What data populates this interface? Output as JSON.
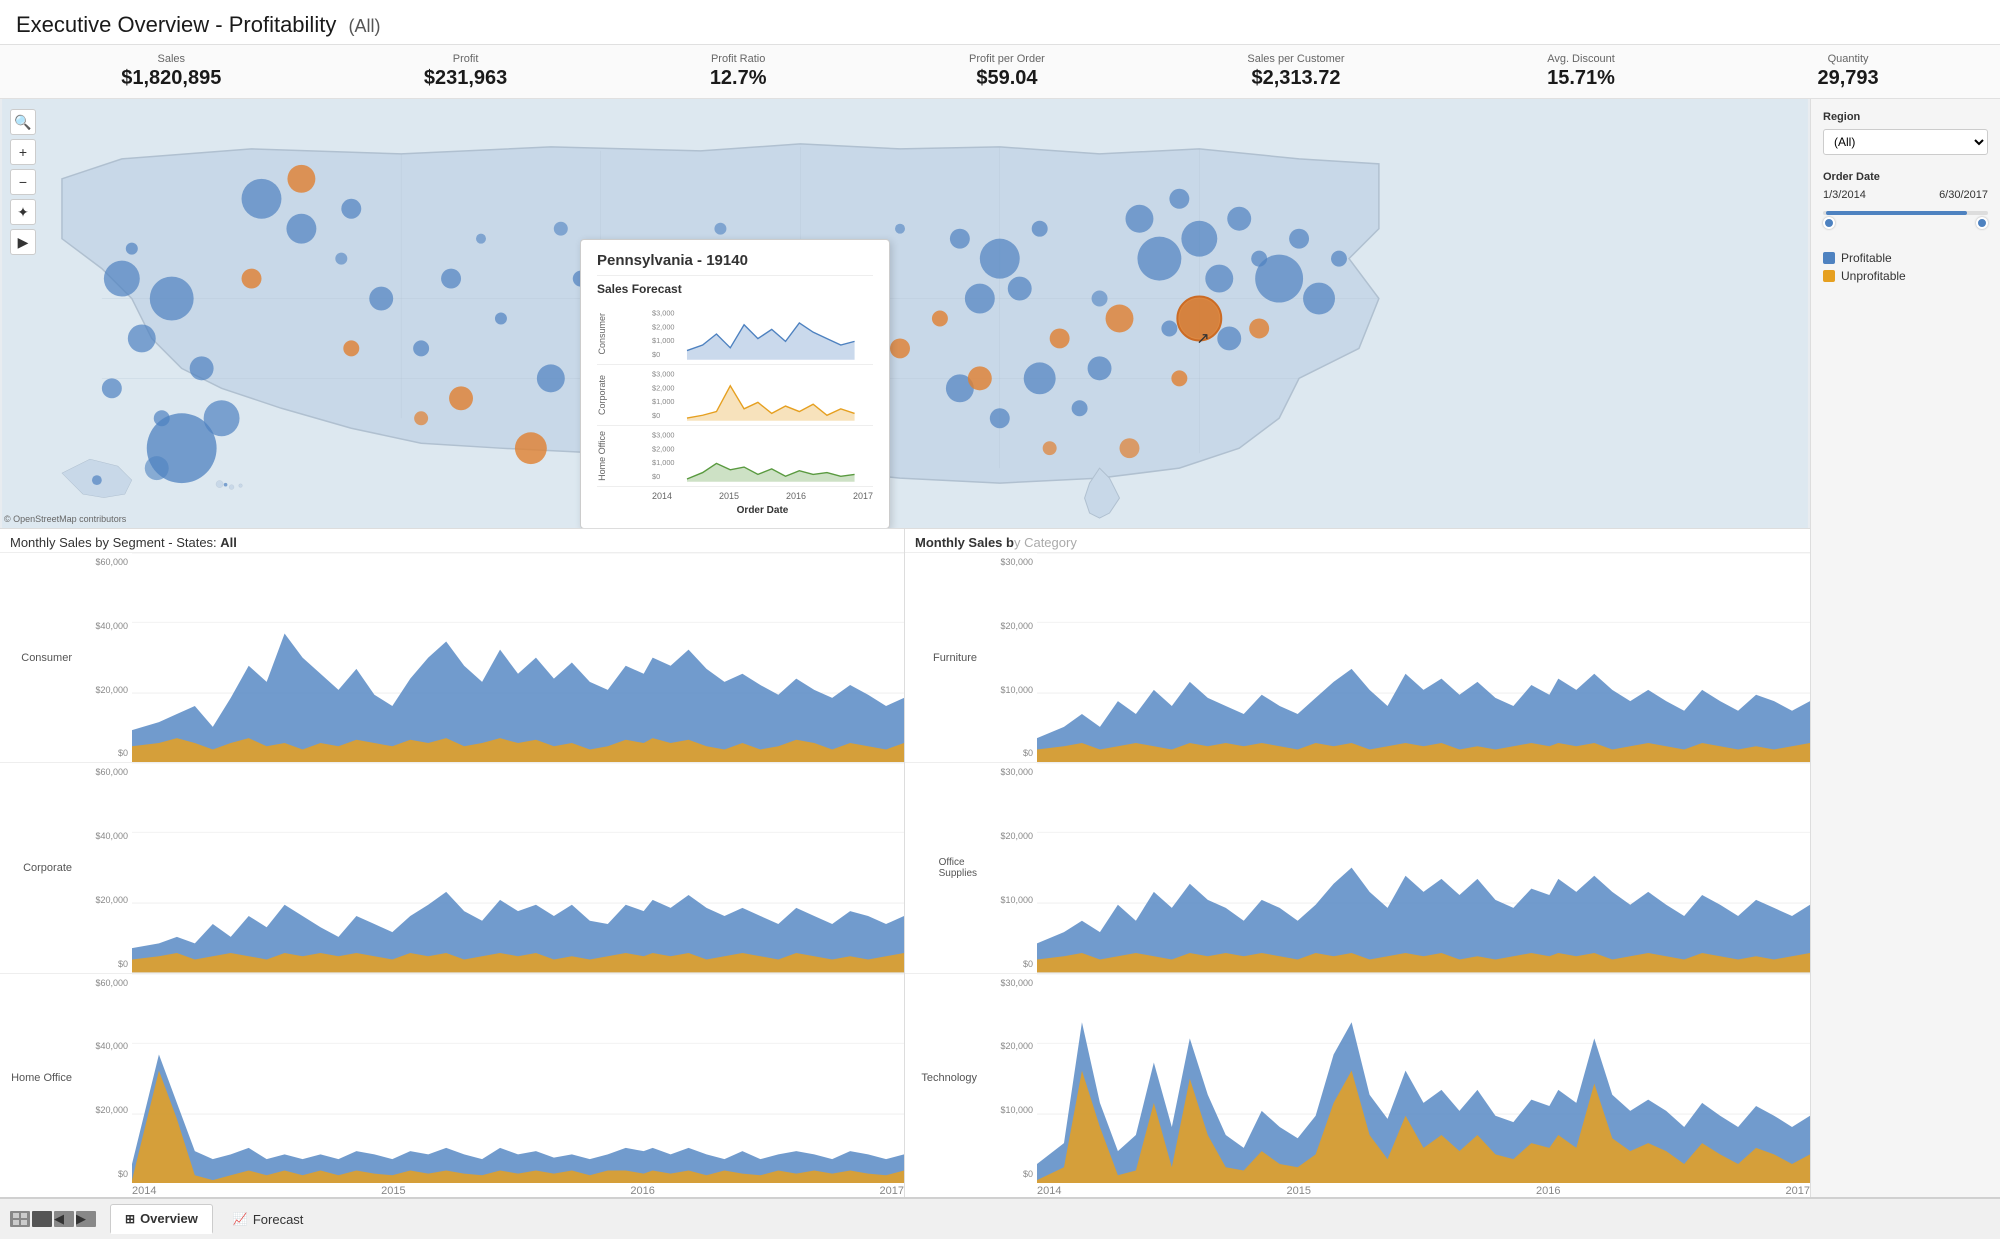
{
  "header": {
    "title": "Executive Overview - Profitability",
    "filter": "(All)"
  },
  "kpis": [
    {
      "label": "Sales",
      "value": "$1,820,895"
    },
    {
      "label": "Profit",
      "value": "$231,963"
    },
    {
      "label": "Profit Ratio",
      "value": "12.7%"
    },
    {
      "label": "Profit per Order",
      "value": "$59.04"
    },
    {
      "label": "Sales per Customer",
      "value": "$2,313.72"
    },
    {
      "label": "Avg. Discount",
      "value": "15.71%"
    },
    {
      "label": "Quantity",
      "value": "29,793"
    }
  ],
  "map": {
    "attribution": "© OpenStreetMap contributors",
    "controls": [
      "+",
      "−",
      "✦",
      "▶"
    ]
  },
  "tooltip": {
    "title": "Pennsylvania - 19140",
    "subtitle": "Sales Forecast",
    "rows": [
      {
        "label": "Consumer",
        "color": "#4e82c0"
      },
      {
        "label": "Corporate",
        "color": "#e6a020"
      },
      {
        "label": "Home Office",
        "color": "#5a9a40"
      }
    ],
    "x_labels": [
      "2014",
      "2015",
      "2016",
      "2017"
    ],
    "x_axis_title": "Order Date",
    "y_labels": [
      "$3,000",
      "$2,000",
      "$1,000",
      "$0"
    ]
  },
  "charts_left": {
    "title": "Monthly Sales by Segment - States:",
    "title_highlight": "All",
    "segments": [
      "Consumer",
      "Corporate",
      "Home Office"
    ],
    "x_labels": [
      "2014",
      "2015",
      "2016",
      "2017"
    ],
    "y_labels": [
      "$60,000",
      "$40,000",
      "$20,000",
      "$0"
    ]
  },
  "charts_right": {
    "title": "Monthly Sales b",
    "categories": [
      "Furniture",
      "Office Supplies",
      "Technology"
    ],
    "x_labels": [
      "2014",
      "2015",
      "2016",
      "2017"
    ],
    "y_labels": [
      "$30,000",
      "$20,000",
      "$10,000",
      "$0"
    ]
  },
  "sidebar": {
    "region_label": "Region",
    "region_value": "(All)",
    "order_date_label": "Order Date",
    "date_start": "1/3/2014",
    "date_end": "6/30/2017",
    "legend": [
      {
        "label": "Profitable",
        "color": "#4e82c0"
      },
      {
        "label": "Unprofitable",
        "color": "#e6a020"
      }
    ]
  },
  "bottom_nav": {
    "tabs": [
      "Overview",
      "Forecast"
    ],
    "active": "Overview",
    "icons": [
      "⊞",
      "📈"
    ]
  },
  "colors": {
    "profitable": "#4e82c0",
    "unprofitable": "#e08030",
    "chart_blue": "#4e82c0",
    "chart_orange": "#e6a020",
    "chart_green": "#5a9a40"
  }
}
